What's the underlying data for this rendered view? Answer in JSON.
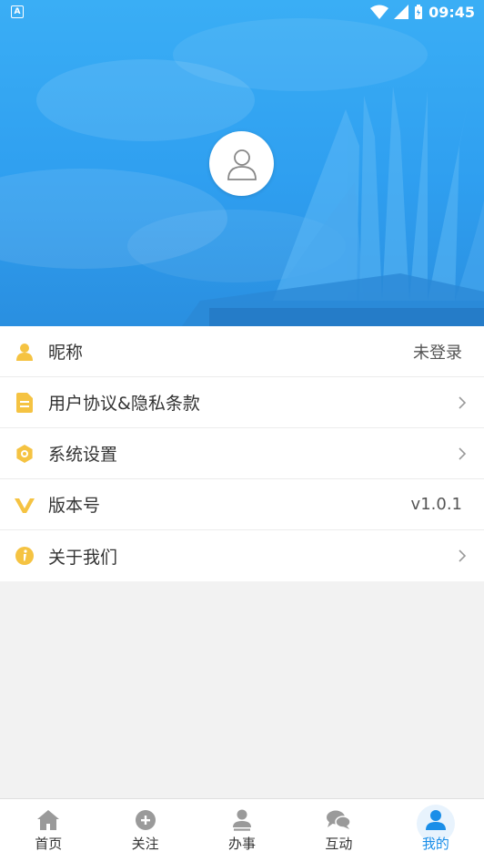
{
  "status_bar": {
    "notification_icon": "app-notification-icon",
    "time": "09:45"
  },
  "profile": {
    "avatar_icon": "user-avatar-icon"
  },
  "menu": [
    {
      "label": "昵称",
      "value": "未登录",
      "icon": "person-icon",
      "color": "#f5c342"
    },
    {
      "label": "用户协议&隐私条款",
      "value": "",
      "icon": "document-icon",
      "color": "#f5c342"
    },
    {
      "label": "系统设置",
      "value": "",
      "icon": "settings-icon",
      "color": "#f5c342"
    },
    {
      "label": "版本号",
      "value": "v1.0.1",
      "icon": "version-icon",
      "color": "#f5c342"
    },
    {
      "label": "关于我们",
      "value": "",
      "icon": "info-icon",
      "color": "#f5c342"
    }
  ],
  "tabs": [
    {
      "label": "首页",
      "icon": "home-icon",
      "active": false
    },
    {
      "label": "关注",
      "icon": "add-icon",
      "active": false
    },
    {
      "label": "办事",
      "icon": "user-icon",
      "active": false
    },
    {
      "label": "互动",
      "icon": "chat-icon",
      "active": false
    },
    {
      "label": "我的",
      "icon": "profile-icon",
      "active": true
    }
  ],
  "colors": {
    "header_blue": "#3aaef5",
    "accent": "#1a8ee8",
    "icon_yellow": "#f5c342"
  }
}
